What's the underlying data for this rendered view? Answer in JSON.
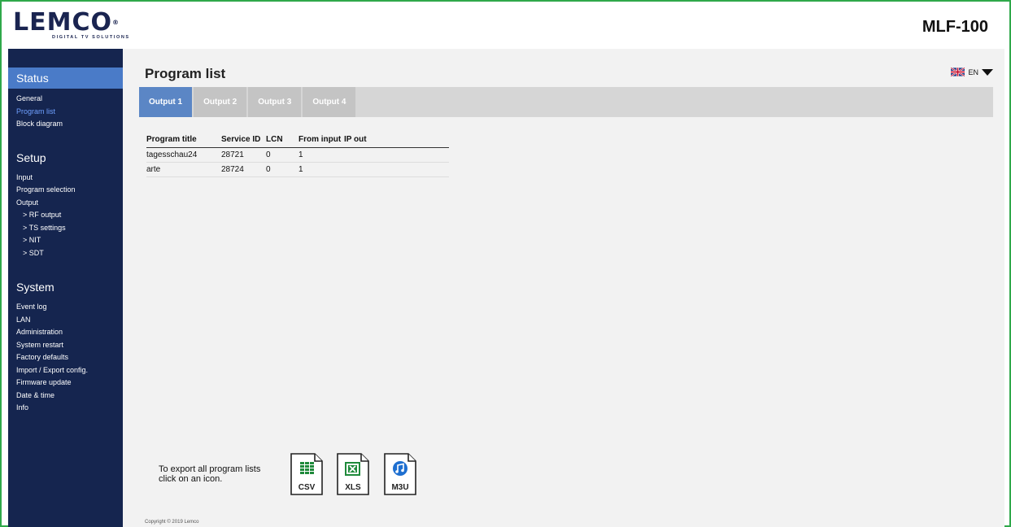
{
  "header": {
    "brand": "LEMCO",
    "brand_tagline": "DIGITAL TV SOLUTIONS",
    "model": "MLF-100"
  },
  "sidebar": {
    "sections": [
      {
        "title": "Status",
        "items": [
          {
            "label": "General"
          },
          {
            "label": "Program list"
          },
          {
            "label": "Block diagram"
          }
        ]
      },
      {
        "title": "Setup",
        "items": [
          {
            "label": "Input"
          },
          {
            "label": "Program selection"
          },
          {
            "label": "Output"
          },
          {
            "label": "> RF output"
          },
          {
            "label": "> TS settings"
          },
          {
            "label": "> NIT"
          },
          {
            "label": "> SDT"
          }
        ]
      },
      {
        "title": "System",
        "items": [
          {
            "label": "Event log"
          },
          {
            "label": "LAN"
          },
          {
            "label": "Administration"
          },
          {
            "label": "System restart"
          },
          {
            "label": "Factory defaults"
          },
          {
            "label": "Import / Export config."
          },
          {
            "label": "Firmware update"
          },
          {
            "label": "Date & time"
          },
          {
            "label": "Info"
          }
        ]
      }
    ]
  },
  "main": {
    "title": "Program list",
    "language": "EN",
    "tabs": [
      {
        "label": "Output 1"
      },
      {
        "label": "Output 2"
      },
      {
        "label": "Output 3"
      },
      {
        "label": "Output 4"
      }
    ],
    "table": {
      "columns": [
        "Program title",
        "Service ID",
        "LCN",
        "From input",
        "IP out"
      ],
      "rows": [
        [
          "tagesschau24",
          "28721",
          "0",
          "1",
          ""
        ],
        [
          "arte",
          "28724",
          "0",
          "1",
          ""
        ]
      ]
    },
    "export": {
      "line1": "To export all program lists",
      "line2": "click on an icon.",
      "files": [
        {
          "label": "CSV",
          "color": "#1f8a3b"
        },
        {
          "label": "XLS",
          "color": "#1f8a3b"
        },
        {
          "label": "M3U",
          "color": "#1e6fd0"
        }
      ]
    },
    "copyright": "Copyright © 2019 Lemco"
  },
  "colors": {
    "sidebar_bg": "#15254f",
    "active_accent": "#4a7bc8",
    "tab_active": "#5b86c5",
    "frame_border": "#2fa84a"
  }
}
